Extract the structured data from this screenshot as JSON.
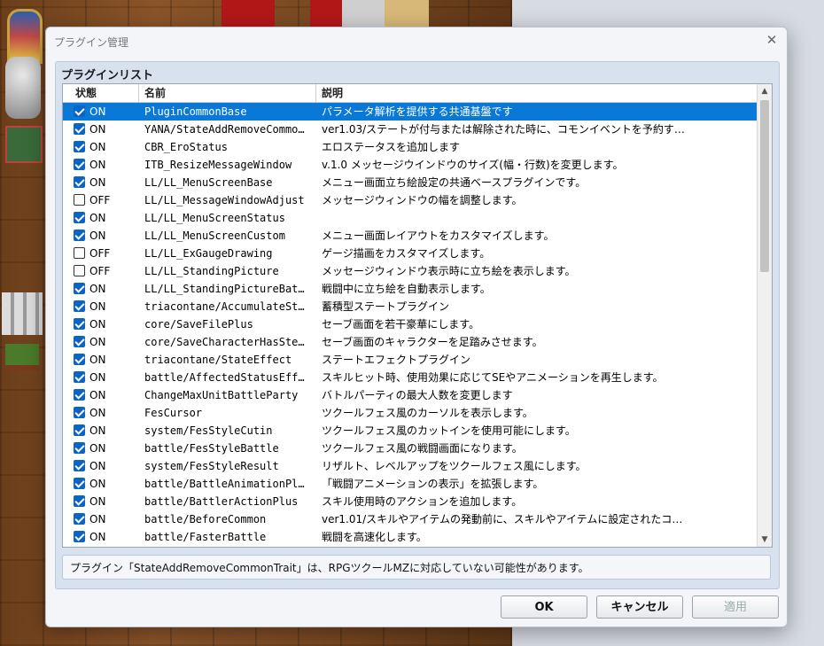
{
  "dialog": {
    "title": "プラグイン管理",
    "close_glyph": "✕",
    "group_title": "プラグインリスト",
    "columns": {
      "status": "状態",
      "name": "名前",
      "desc": "説明"
    },
    "message": "プラグイン「StateAddRemoveCommonTrait」は、RPGツクールMZに対応していない可能性があります。",
    "buttons": {
      "ok": "OK",
      "cancel": "キャンセル",
      "apply": "適用"
    },
    "selected_row_color": "#0a78d7"
  },
  "plugins": [
    {
      "status": "ON",
      "name": "PluginCommonBase",
      "desc": "パラメータ解析を提供する共通基盤です",
      "selected": true
    },
    {
      "status": "ON",
      "name": "YANA/StateAddRemoveCommo…",
      "desc": "ver1.03/ステートが付与または解除された時に、コモンイベントを予約す…"
    },
    {
      "status": "ON",
      "name": "CBR_EroStatus",
      "desc": "エロステータスを追加します"
    },
    {
      "status": "ON",
      "name": "ITB_ResizeMessageWindow",
      "desc": "v.1.0 メッセージウインドウのサイズ(幅・行数)を変更します。"
    },
    {
      "status": "ON",
      "name": "LL/LL_MenuScreenBase",
      "desc": "メニュー画面立ち絵設定の共通ベースプラグインです。"
    },
    {
      "status": "OFF",
      "name": "LL/LL_MessageWindowAdjust",
      "desc": "メッセージウィンドウの幅を調整します。"
    },
    {
      "status": "ON",
      "name": "LL/LL_MenuScreenStatus",
      "desc": ""
    },
    {
      "status": "ON",
      "name": "LL/LL_MenuScreenCustom",
      "desc": "メニュー画面レイアウトをカスタマイズします。"
    },
    {
      "status": "OFF",
      "name": "LL/LL_ExGaugeDrawing",
      "desc": "ゲージ描画をカスタマイズします。"
    },
    {
      "status": "OFF",
      "name": "LL/LL_StandingPicture",
      "desc": "メッセージウィンドウ表示時に立ち絵を表示します。"
    },
    {
      "status": "ON",
      "name": "LL/LL_StandingPictureBat…",
      "desc": "戦闘中に立ち絵を自動表示します。"
    },
    {
      "status": "ON",
      "name": "triacontane/AccumulateSt…",
      "desc": "蓄積型ステートプラグイン"
    },
    {
      "status": "ON",
      "name": "core/SaveFilePlus",
      "desc": "セーブ画面を若干豪華にします。"
    },
    {
      "status": "ON",
      "name": "core/SaveCharacterHasSte…",
      "desc": "セーブ画面のキャラクターを足踏みさせます。"
    },
    {
      "status": "ON",
      "name": "triacontane/StateEffect",
      "desc": "ステートエフェクトプラグイン"
    },
    {
      "status": "ON",
      "name": "battle/AffectedStatusEff…",
      "desc": "スキルヒット時、使用効果に応じてSEやアニメーションを再生します。"
    },
    {
      "status": "ON",
      "name": "ChangeMaxUnitBattleParty",
      "desc": "バトルパーティの最大人数を変更します"
    },
    {
      "status": "ON",
      "name": "FesCursor",
      "desc": "ツクールフェス風のカーソルを表示します。"
    },
    {
      "status": "ON",
      "name": "system/FesStyleCutin",
      "desc": "ツクールフェス風のカットインを使用可能にします。"
    },
    {
      "status": "ON",
      "name": "battle/FesStyleBattle",
      "desc": "ツクールフェス風の戦闘画面になります。"
    },
    {
      "status": "ON",
      "name": "system/FesStyleResult",
      "desc": "リザルト、レベルアップをツクールフェス風にします。"
    },
    {
      "status": "ON",
      "name": "battle/BattleAnimationPlus",
      "desc": "「戦闘アニメーションの表示」を拡張します。"
    },
    {
      "status": "ON",
      "name": "battle/BattlerActionPlus",
      "desc": "スキル使用時のアクションを追加します。"
    },
    {
      "status": "ON",
      "name": "battle/BeforeCommon",
      "desc": "ver1.01/スキルやアイテムの発動前に、スキルやアイテムに設定されたコ…"
    },
    {
      "status": "ON",
      "name": "battle/FasterBattle",
      "desc": "戦闘を高速化します。"
    }
  ]
}
